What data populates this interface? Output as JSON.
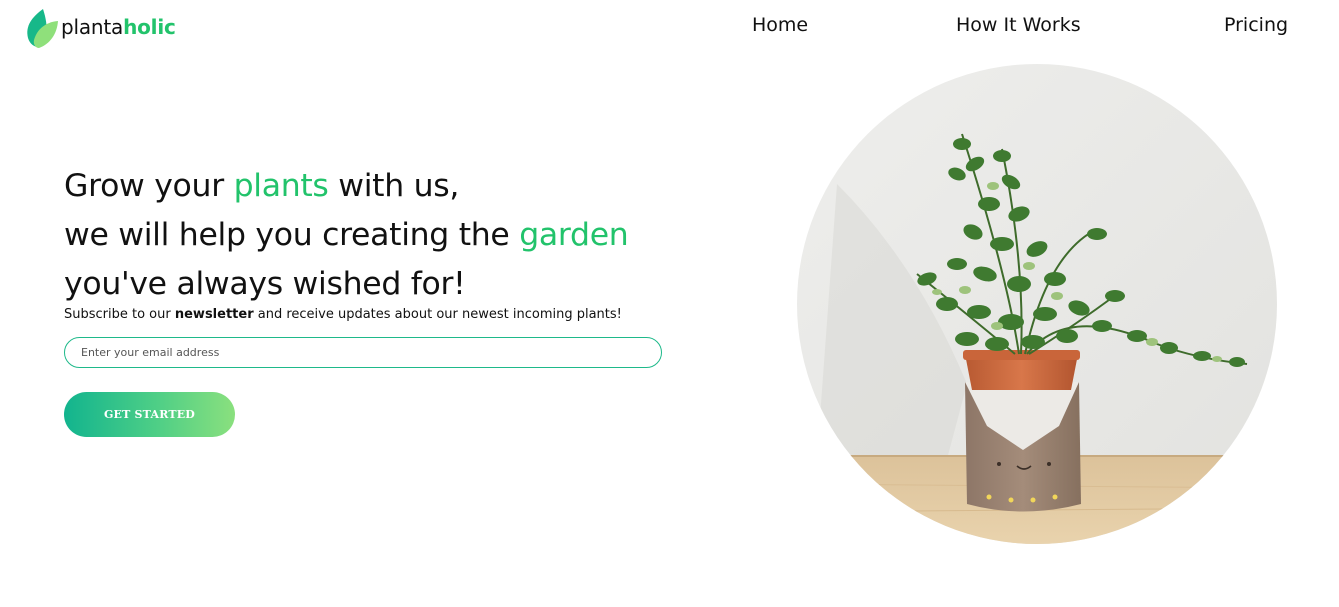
{
  "brand": {
    "name_part1": "planta",
    "name_part2": "holic",
    "icon": "leaf-icon",
    "accent_color": "#22c36b"
  },
  "nav": {
    "items": [
      {
        "label": "Home"
      },
      {
        "label": "How It Works"
      },
      {
        "label": "Pricing"
      }
    ]
  },
  "hero": {
    "line1_prefix": "Grow your ",
    "line1_accent": "plants",
    "line1_suffix": " with us,",
    "line2_prefix": "we will help you creating the ",
    "line2_accent": "garden",
    "line3": "you've always wished for!"
  },
  "subscribe": {
    "prefix": "Subscribe to our ",
    "bold": "newsletter",
    "suffix": " and receive updates about our newest incoming plants!"
  },
  "email_field": {
    "placeholder": "Enter your email address",
    "value": ""
  },
  "cta": {
    "label": "GET STARTED",
    "gradient_start": "#12b48e",
    "gradient_end": "#8ae07e"
  },
  "illustration": {
    "subject": "potted-plant-photo"
  }
}
